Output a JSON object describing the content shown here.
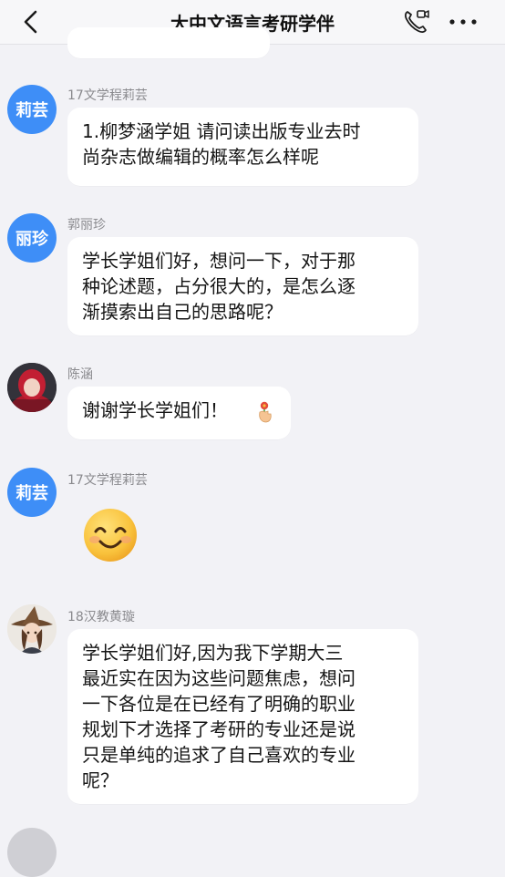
{
  "header": {
    "title": "大中文语言考研学伴",
    "back_icon": "back-chevron-icon",
    "call_icon": "video-call-icon",
    "more_icon": "more-dots-icon"
  },
  "messages": [
    {
      "sender": "17文学程莉芸",
      "avatar_text": "莉芸",
      "text_lines": [
        "1.柳梦涵学姐 请问读出版专业去时",
        "尚杂志做编辑的概率怎么样呢"
      ]
    },
    {
      "sender": "郭丽珍",
      "avatar_text": "丽珍",
      "text_lines": [
        "学长学姐们好，想问一下，对于那",
        "种论述题，占分很大的，是怎么逐",
        "渐摸索出自己的思路呢？"
      ]
    },
    {
      "sender": "陈涵",
      "avatar_icon": "red-hood-avatar",
      "text": "谢谢学长学姐们！",
      "emoji": "hand-holding-flower-icon"
    },
    {
      "sender": "17文学程莉芸",
      "avatar_text": "莉芸",
      "sticker": "smiley-face-icon"
    },
    {
      "sender": "18汉教黄璇",
      "avatar_icon": "witch-girl-avatar",
      "text_lines": [
        "学长学姐们好,因为我下学期大三",
        "最近实在因为这些问题焦虑，想问",
        "一下各位是在已经有了明确的职业",
        "规划下才选择了考研的专业还是说",
        "只是单纯的追求了自己喜欢的专业",
        "呢？"
      ]
    }
  ],
  "colors": {
    "background": "#f2f2f6",
    "avatar_blue": "#3e8ef7",
    "bubble": "#ffffff",
    "sender_gray": "#8a8a8e"
  }
}
